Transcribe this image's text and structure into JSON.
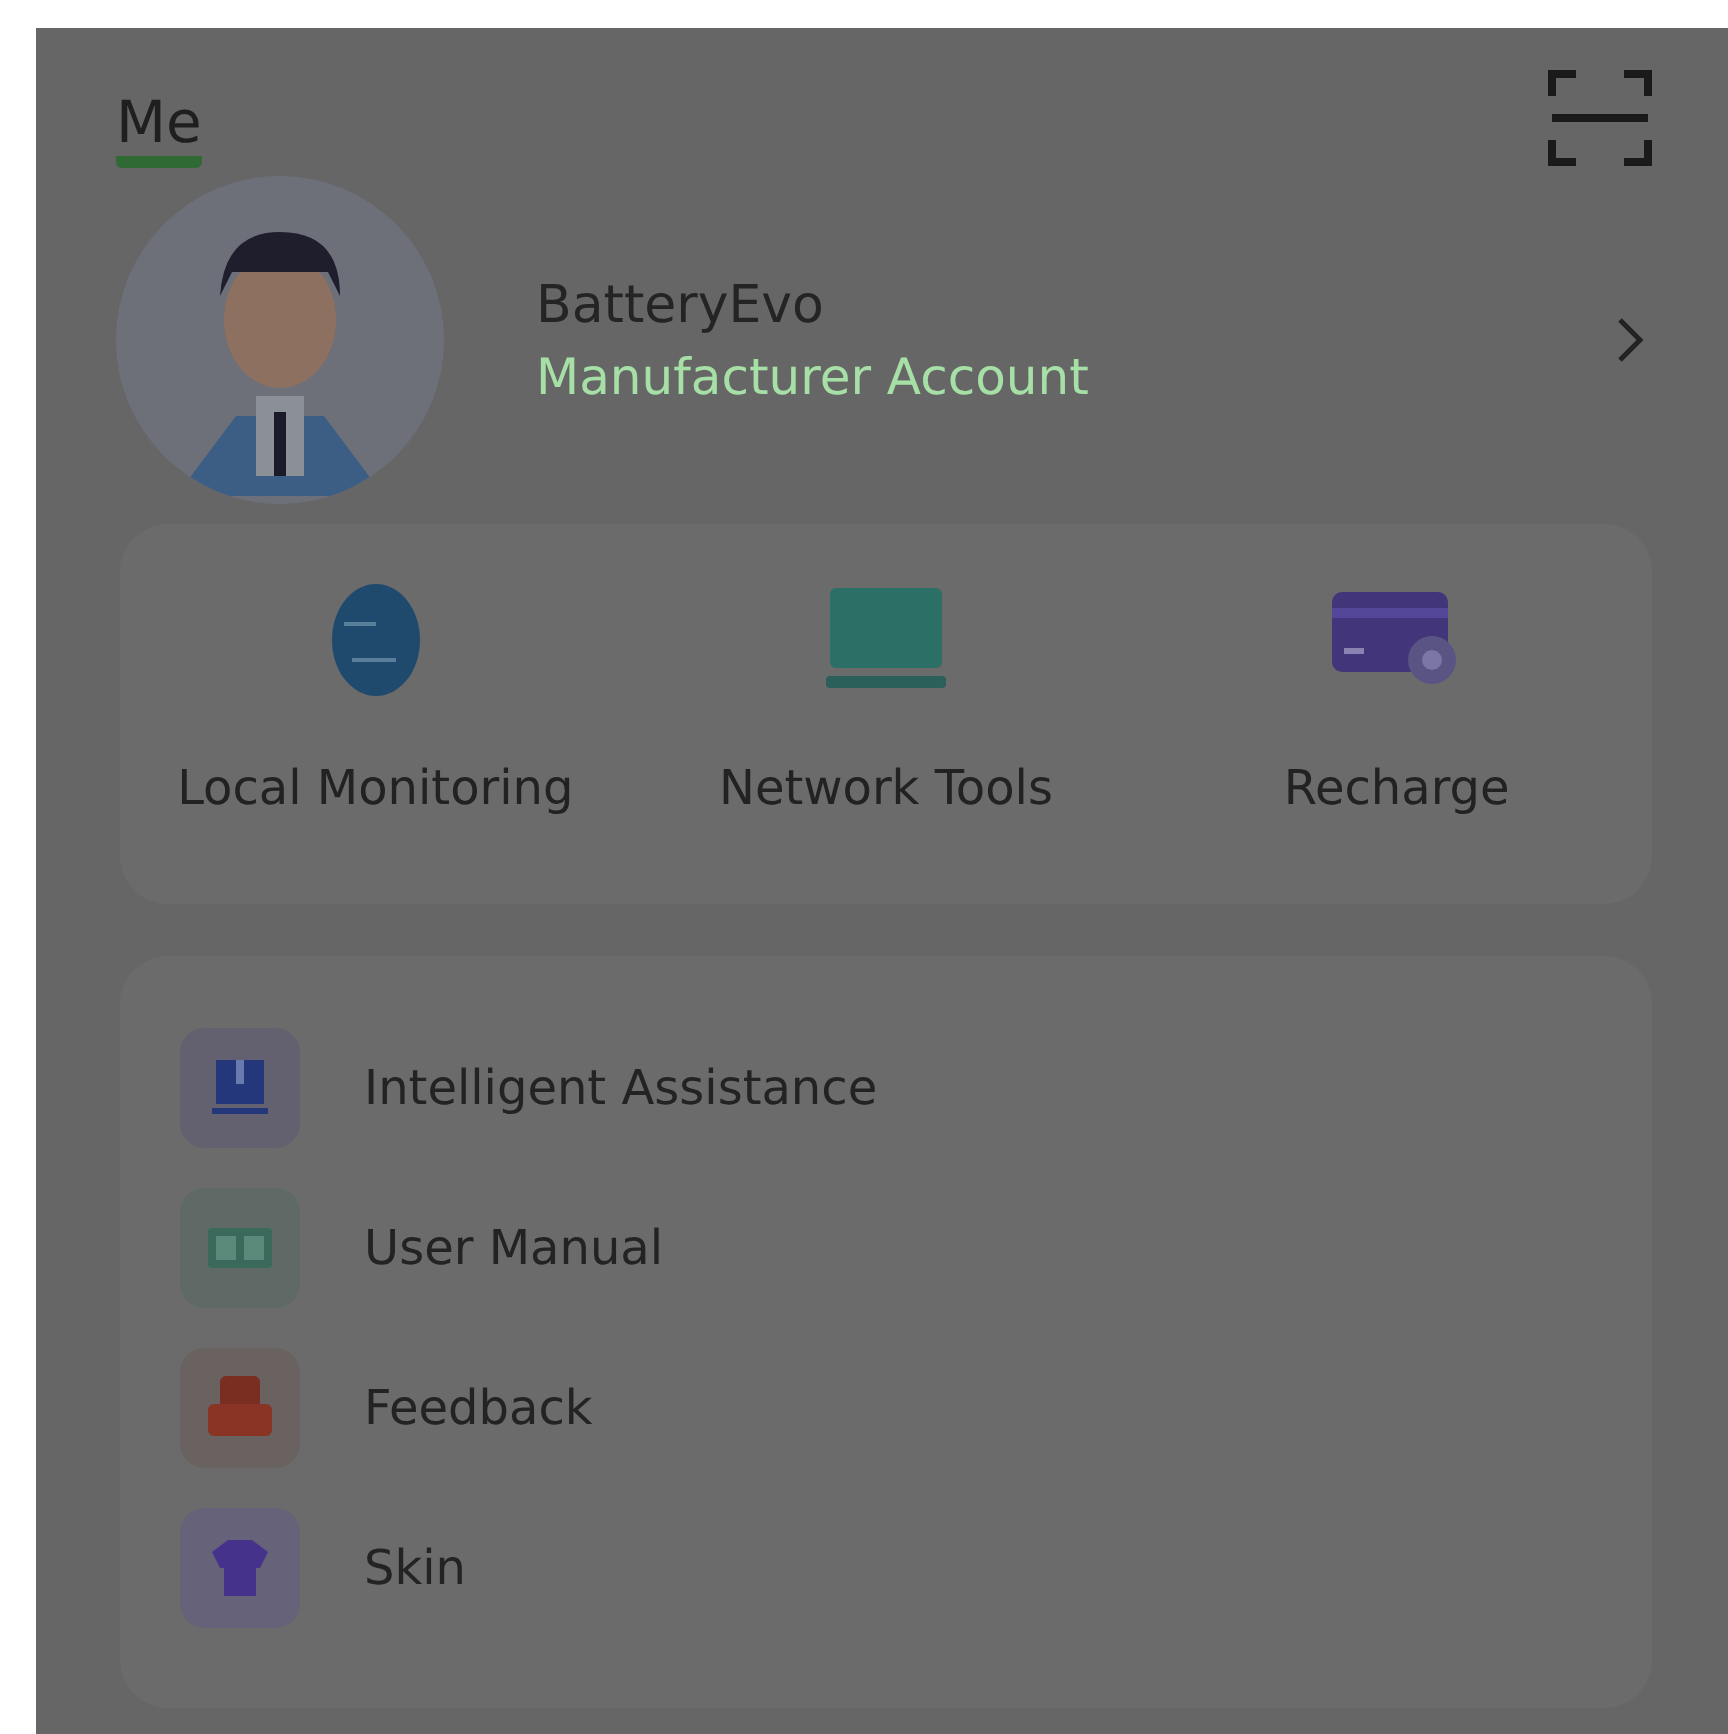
{
  "header": {
    "title": "Me"
  },
  "profile": {
    "name": "BatteryEvo",
    "role": "Manufacturer Account"
  },
  "quick_tools": [
    {
      "label": "Local Monitoring",
      "kind": "monitor"
    },
    {
      "label": "Network Tools",
      "kind": "network"
    },
    {
      "label": "Recharge",
      "kind": "card"
    }
  ],
  "menu": [
    {
      "label": "Intelligent Assistance",
      "kind": "assistant"
    },
    {
      "label": "User Manual",
      "kind": "manual"
    },
    {
      "label": "Feedback",
      "kind": "feedback"
    },
    {
      "label": "Skin",
      "kind": "skin"
    }
  ]
}
